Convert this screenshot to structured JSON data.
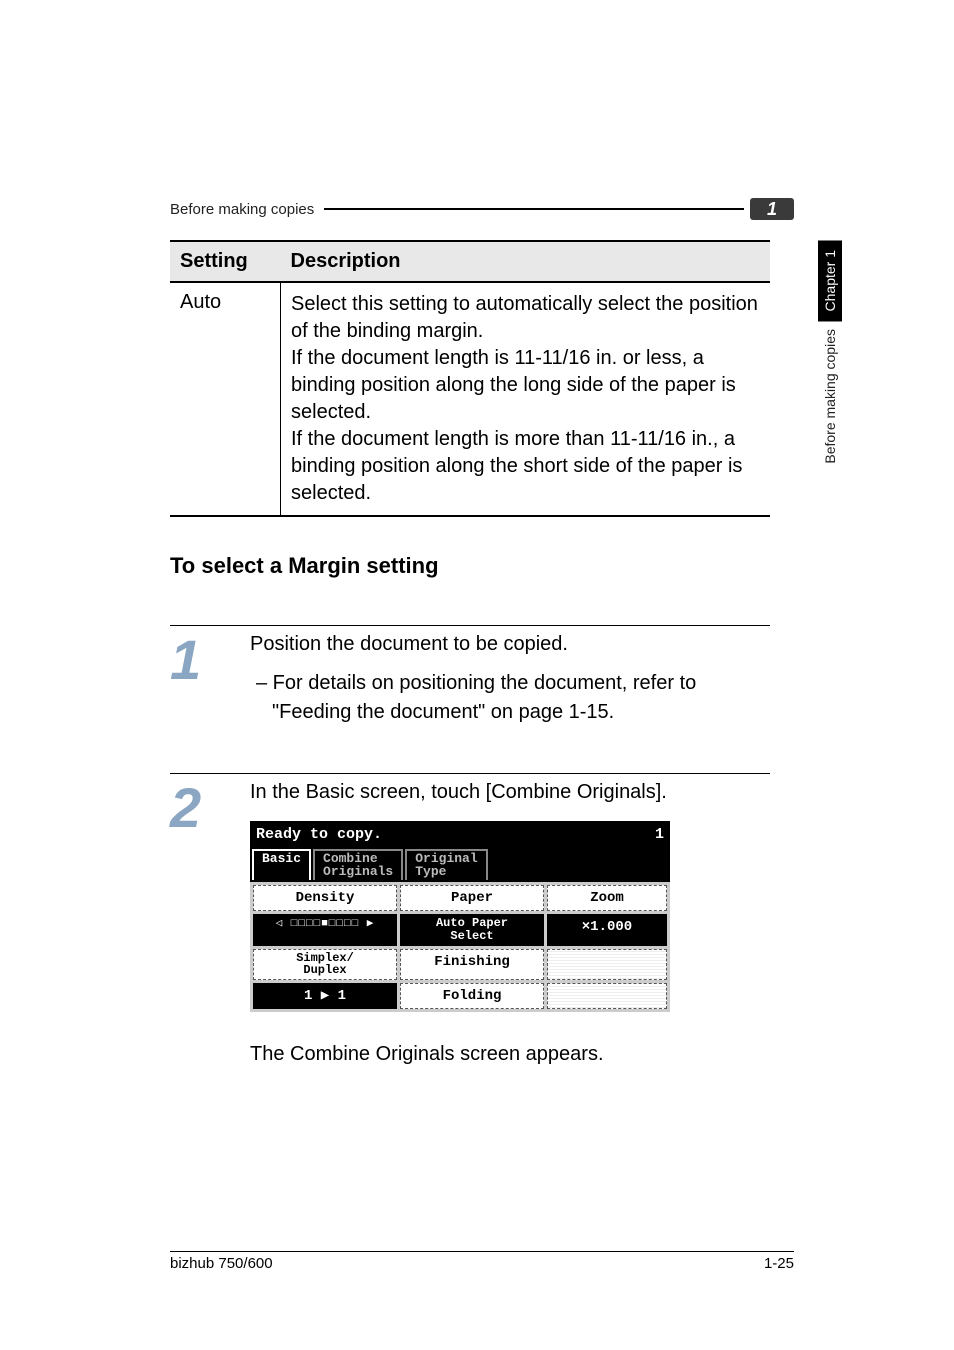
{
  "header": {
    "running_title": "Before making copies",
    "chip": "1"
  },
  "side_tab": {
    "black": "Chapter 1",
    "label": "Before making copies"
  },
  "table": {
    "headers": [
      "Setting",
      "Description"
    ],
    "row": {
      "setting": "Auto",
      "desc": "Select this setting to automatically select the position of the binding margin.\nIf the document length is 11-11/16 in. or less, a binding position along the long side of the paper is selected.\nIf the document length is more than 11-11/16 in., a binding position along the short side of the paper is selected."
    }
  },
  "section_heading": "To select a Margin setting",
  "steps": [
    {
      "num": "1",
      "text": "Position the document to be copied.",
      "sub": "– For details on positioning the document, refer to \"Feeding the document\" on page 1-15."
    },
    {
      "num": "2",
      "text": "In the Basic screen, touch [Combine Originals].",
      "after_ui": "The Combine Originals screen appears."
    }
  ],
  "ui": {
    "ready": "Ready to copy.",
    "count": "1",
    "tabs": {
      "basic": "Basic",
      "combine": "Combine\nOriginals",
      "original": "Original\nType"
    },
    "row1": {
      "density": "Density",
      "paper": "Paper",
      "zoom": "Zoom"
    },
    "row2": {
      "density_bar": "◁ □□□□■□□□□ ▶",
      "auto_paper": "Auto Paper\nSelect",
      "zoom_val": "×1.000"
    },
    "row3": {
      "simplex": "Simplex/\nDuplex",
      "finishing": "Finishing"
    },
    "row4": {
      "one_one": "1 ▶ 1",
      "folding": "Folding"
    }
  },
  "footer": {
    "model": "bizhub 750/600",
    "page": "1-25"
  }
}
